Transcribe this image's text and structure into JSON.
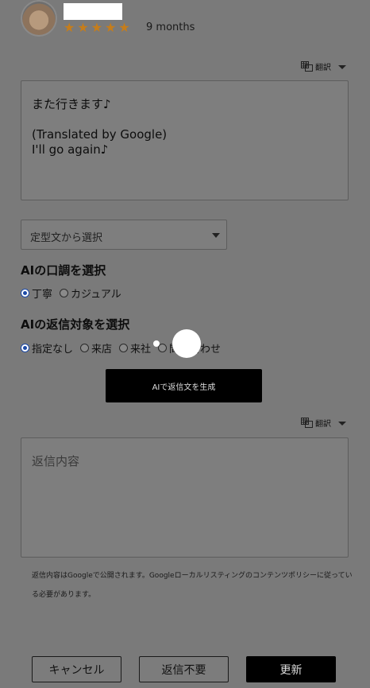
{
  "review": {
    "stars": "★★★★★",
    "age": "9 months",
    "text": "また行きます♪\n\n(Translated by Google)\nI'll go again♪"
  },
  "translate_label": "翻訳",
  "template_select": {
    "placeholder": "定型文から選択"
  },
  "tone": {
    "title": "AIの口調を選択",
    "options": [
      {
        "label": "丁寧",
        "selected": true
      },
      {
        "label": "カジュアル",
        "selected": false
      }
    ]
  },
  "target": {
    "title": "AIの返信対象を選択",
    "options": [
      {
        "label": "指定なし",
        "selected": true
      },
      {
        "label": "来店",
        "selected": false
      },
      {
        "label": "来社",
        "selected": false
      },
      {
        "label": "問い合わせ",
        "selected": false
      }
    ]
  },
  "generate_button": "AIで返信文を生成",
  "reply": {
    "placeholder": "返信内容"
  },
  "policy_text": "返信内容はGoogleで公開されます。Googleローカルリスティングのコンテンツポリシーに従っている必要があります。",
  "buttons": {
    "cancel": "キャンセル",
    "no_reply": "返信不要",
    "update": "更新"
  }
}
